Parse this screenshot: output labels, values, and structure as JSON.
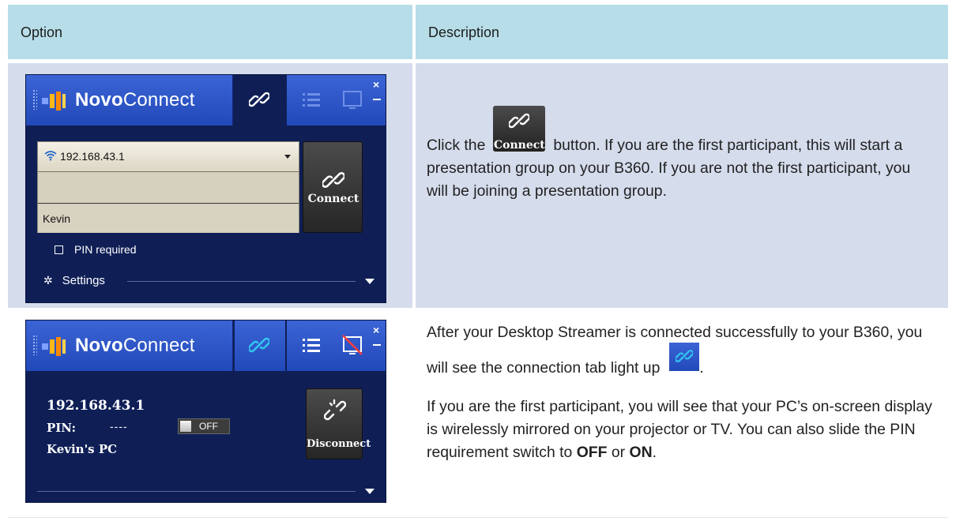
{
  "table": {
    "header_option": "Option",
    "header_description": "Description"
  },
  "panel": {
    "brand_bold": "Novo",
    "brand_light": "Connect",
    "close_glyph": "×"
  },
  "row1": {
    "ip_address": "192.168.43.1",
    "name_value": "Kevin",
    "connect_label": "Connect",
    "pin_required_label": "PIN required",
    "settings_label": "Settings",
    "desc_before": "Click the",
    "desc_inline_label": "Connect",
    "desc_after": "button. If you are the first participant, this will start a presentation group on your B360. If you are not the first participant, you will be joining a presentation group."
  },
  "row2": {
    "ip_address": "192.168.43.1",
    "pin_label": "PIN:",
    "pin_value": "----",
    "toggle_label": "OFF",
    "pc_name": "Kevin's PC",
    "disconnect_label": "Disconnect",
    "desc_p1": "After your Desktop Streamer is connected successfully to your B360, you will see the connection tab light up",
    "desc_p1_end": ".",
    "desc_p2_a": "If you are the first participant, you will see that your PC’s on-screen display is wirelessly mirrored on your projector or TV. You can also slide the PIN requirement switch to",
    "desc_p2_off": "OFF",
    "desc_p2_or": "or",
    "desc_p2_on": "ON",
    "desc_p2_end": "."
  },
  "colors": {
    "header_bg": "#b7dde8",
    "row1_bg": "#d5dcec",
    "panel_bg": "#0f1f56",
    "tab_blue": "#2249b8",
    "active_link_icon": "#33c3f0"
  },
  "icons": [
    "link-icon",
    "list-icon",
    "screen-icon",
    "wifi-icon",
    "gear-icon",
    "close-icon",
    "minimize-icon",
    "logo-icon"
  ]
}
